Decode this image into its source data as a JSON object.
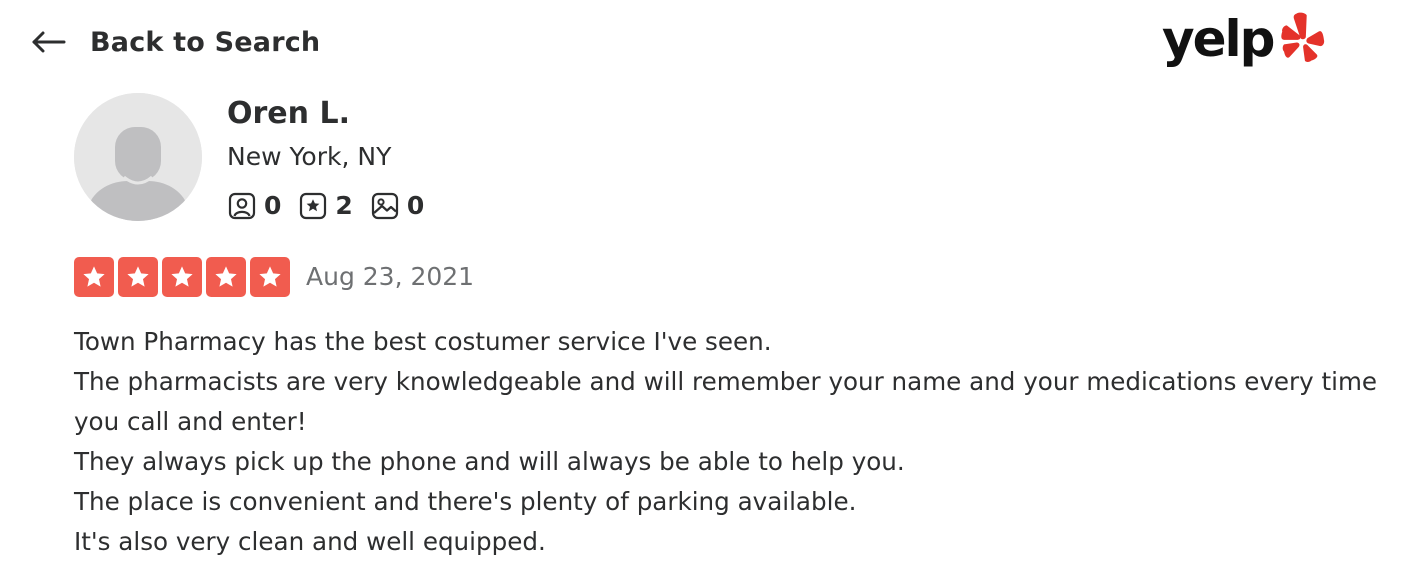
{
  "header": {
    "back_label": "Back to Search",
    "logo_text": "yelp",
    "logo_color": "#d32323"
  },
  "reviewer": {
    "name": "Oren L.",
    "location": "New York, NY",
    "friends_count": "0",
    "reviews_count": "2",
    "photos_count": "0"
  },
  "review": {
    "rating": 5,
    "rating_max": 5,
    "star_color": "#f15c4f",
    "date": "Aug 23, 2021",
    "lines": [
      "Town Pharmacy has the best costumer service I've seen.",
      "The pharmacists are very knowledgeable and will remember your name and your medications every time you call and enter!",
      "They always pick up the phone and will always be able to help you.",
      "The place is convenient and there's plenty of parking available.",
      "It's also very clean and well equipped."
    ]
  },
  "icons": {
    "back": "arrow-left-icon",
    "friends": "friends-icon",
    "reviews": "reviews-star-icon",
    "photos": "photos-icon",
    "logo_burst": "yelp-burst-icon"
  }
}
